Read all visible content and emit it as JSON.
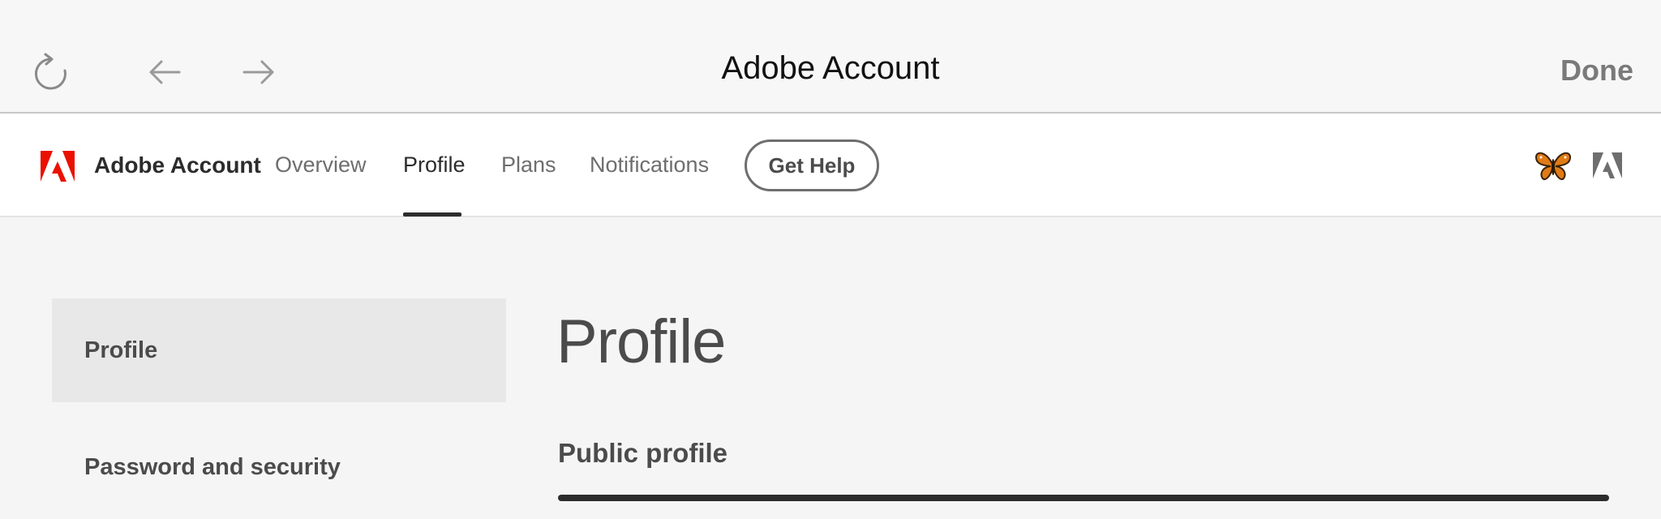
{
  "browser_bar": {
    "title": "Adobe Account",
    "done_label": "Done",
    "icons": [
      "reload-icon",
      "back-arrow-icon",
      "forward-arrow-icon"
    ]
  },
  "site_nav": {
    "brand_name": "Adobe Account",
    "tabs": [
      {
        "label": "Overview",
        "active": false
      },
      {
        "label": "Profile",
        "active": true
      },
      {
        "label": "Plans",
        "active": false
      },
      {
        "label": "Notifications",
        "active": false
      }
    ],
    "help_label": "Get Help",
    "icons": [
      "adobe-logo-icon",
      "butterfly-avatar-icon",
      "adobe-apps-icon"
    ]
  },
  "sidebar": {
    "items": [
      {
        "label": "Profile",
        "selected": true
      },
      {
        "label": "Password and security",
        "selected": false
      }
    ]
  },
  "main": {
    "page_title": "Profile",
    "section_title": "Public profile"
  },
  "colors": {
    "adobe_red": "#eb1000",
    "text_dark": "#2c2c2c",
    "text_muted": "#6e6e6e",
    "page_bg": "#f5f5f5"
  }
}
